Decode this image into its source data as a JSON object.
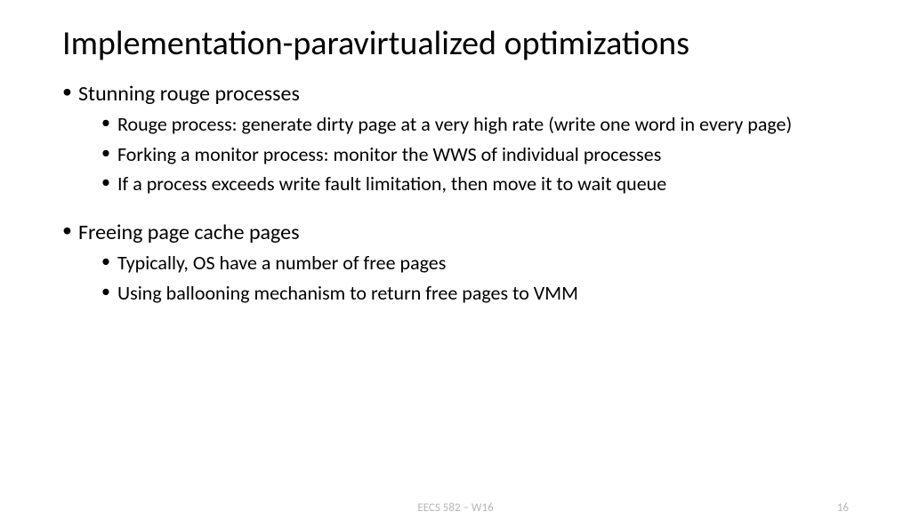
{
  "title": "Implementation-paravirtualized optimizations",
  "sections": [
    {
      "head": "Stunning rouge processes",
      "items": [
        "Rouge process: generate dirty page at a very high rate (write one word in every page)",
        "Forking a monitor process: monitor the WWS of individual processes",
        "If a process exceeds write fault limitation, then move it to wait queue"
      ]
    },
    {
      "head": "Freeing page cache pages",
      "items": [
        "Typically, OS have a number of free pages",
        "Using ballooning mechanism to return free pages to VMM"
      ]
    }
  ],
  "footer": {
    "center": "EECS 582 – W16",
    "page": "16"
  }
}
